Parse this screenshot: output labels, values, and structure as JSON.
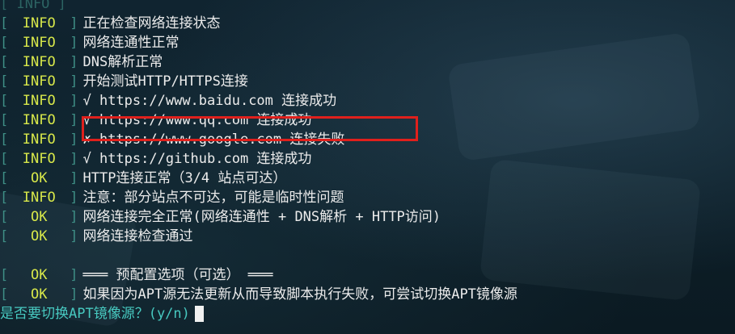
{
  "terminal": {
    "top_fragment": "[ INFO ]",
    "lines": [
      {
        "level": "INFO",
        "message": "正在检查网络连接状态"
      },
      {
        "level": "INFO",
        "message": "网络连通性正常"
      },
      {
        "level": "INFO",
        "message": "DNS解析正常"
      },
      {
        "level": "INFO",
        "message": "开始测试HTTP/HTTPS连接"
      },
      {
        "level": "INFO",
        "message": "√ https://www.baidu.com 连接成功"
      },
      {
        "level": "INFO",
        "message": "√ https://www.qq.com 连接成功"
      },
      {
        "level": "INFO",
        "message": "✗ https://www.google.com 连接失败"
      },
      {
        "level": "INFO",
        "message": "√ https://github.com 连接成功"
      },
      {
        "level": "OK",
        "message": "HTTP连接正常（3/4 站点可达）"
      },
      {
        "level": "INFO",
        "message": "注意：部分站点不可达，可能是临时性问题"
      },
      {
        "level": "OK",
        "message": "网络连接完全正常(网络连通性 + DNS解析 + HTTP访问)"
      },
      {
        "level": "OK",
        "message": "网络连接检查通过"
      }
    ],
    "section_lines": [
      {
        "level": "OK",
        "message": "═══ 预配置选项（可选） ═══"
      },
      {
        "level": "OK",
        "message": "如果因为APT源无法更新从而导致脚本执行失败，可尝试切换APT镜像源"
      }
    ],
    "prompt": "是否要切换APT镜像源？(y/n)",
    "bracket_open": "[",
    "bracket_close": "]"
  },
  "colors": {
    "background": "#0c1d26",
    "bracket": "#3f8f86",
    "level_tag": "#d8e84a",
    "message": "#ececec",
    "prompt": "#47c9c0",
    "highlight_box": "#e0201c"
  }
}
